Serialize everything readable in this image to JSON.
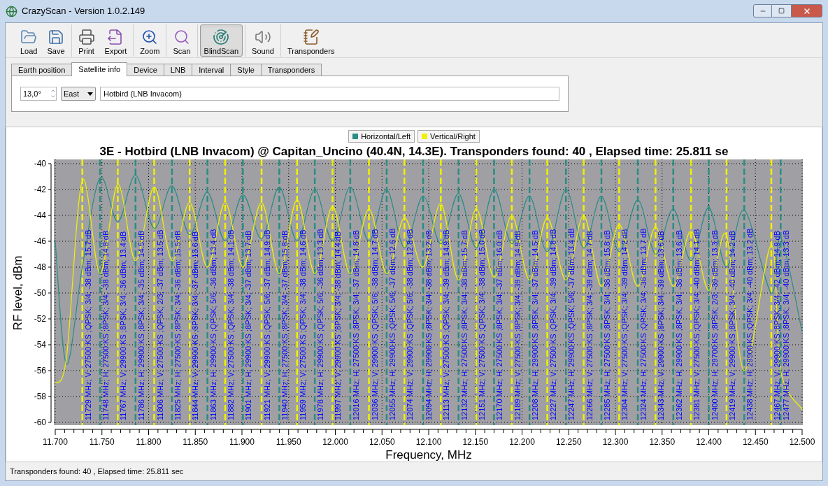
{
  "window": {
    "title": "CrazyScan - Version 1.0.2.149"
  },
  "toolbar": [
    {
      "buttons": [
        {
          "kind": "load",
          "label": "Load",
          "pressed": false
        },
        {
          "kind": "save",
          "label": "Save",
          "pressed": false
        }
      ]
    },
    {
      "buttons": [
        {
          "kind": "print",
          "label": "Print",
          "pressed": false
        },
        {
          "kind": "export",
          "label": "Export",
          "pressed": false
        }
      ]
    },
    {
      "buttons": [
        {
          "kind": "zoom",
          "label": "Zoom",
          "pressed": false
        }
      ]
    },
    {
      "buttons": [
        {
          "kind": "scan",
          "label": "Scan",
          "pressed": false
        }
      ]
    },
    {
      "buttons": [
        {
          "kind": "blindscan",
          "label": "BlindScan",
          "pressed": true
        }
      ]
    },
    {
      "buttons": [
        {
          "kind": "sound",
          "label": "Sound",
          "pressed": false
        }
      ]
    },
    {
      "buttons": [
        {
          "kind": "transponders",
          "label": "Transponders",
          "pressed": false
        }
      ]
    }
  ],
  "tabs": [
    {
      "label": "Earth position",
      "selected": false
    },
    {
      "label": "Satellite info",
      "selected": true
    },
    {
      "label": "Device",
      "selected": false
    },
    {
      "label": "LNB",
      "selected": false
    },
    {
      "label": "Interval",
      "selected": false
    },
    {
      "label": "Style",
      "selected": false
    },
    {
      "label": "Transponders",
      "selected": false
    }
  ],
  "satellite_info": {
    "position": "13,0°",
    "direction": "East",
    "name": "Hotbird (LNB Invacom)"
  },
  "chart": {
    "title": "3E - Hotbird (LNB Invacom) @ Capitan_Uncino (40.4N, 14.3E). Transponders found: 40 , Elapsed time: 25.811 se",
    "chart_data": {
      "type": "line",
      "xlabel": "Frequency, MHz",
      "ylabel": "RF level, dBm",
      "xlim": [
        11.7,
        12.5
      ],
      "ylim": [
        -60,
        -40
      ],
      "xticks": [
        {
          "value": 11.7,
          "label": "11.700"
        },
        {
          "value": 11.75,
          "label": "11.750"
        },
        {
          "value": 11.8,
          "label": "11.800"
        },
        {
          "value": 11.85,
          "label": "11.850"
        },
        {
          "value": 11.9,
          "label": "11.900"
        },
        {
          "value": 11.95,
          "label": "11.950"
        },
        {
          "value": 12.0,
          "label": "12.000"
        },
        {
          "value": 12.05,
          "label": "12.050"
        },
        {
          "value": 12.1,
          "label": "12.100"
        },
        {
          "value": 12.15,
          "label": "12.150"
        },
        {
          "value": 12.2,
          "label": "12.200"
        },
        {
          "value": 12.25,
          "label": "12.250"
        },
        {
          "value": 12.3,
          "label": "12.300"
        },
        {
          "value": 12.35,
          "label": "12.350"
        },
        {
          "value": 12.4,
          "label": "12.400"
        },
        {
          "value": 12.45,
          "label": "12.450"
        },
        {
          "value": 12.5,
          "label": "12.500"
        }
      ],
      "grid": true,
      "yticks": [
        -40,
        -42,
        -44,
        -46,
        -48,
        -50,
        -52,
        -54,
        -56,
        -58,
        -60
      ],
      "x": [
        11.7,
        11.712,
        11.729,
        11.748,
        11.767,
        11.786,
        11.806,
        11.825,
        11.844,
        11.863,
        11.882,
        11.901,
        11.921,
        11.94,
        11.959,
        11.978,
        11.997,
        12.016,
        12.036,
        12.055,
        12.074,
        12.094,
        12.113,
        12.132,
        12.151,
        12.17,
        12.189,
        12.208,
        12.227,
        12.247,
        12.266,
        12.285,
        12.304,
        12.324,
        12.343,
        12.362,
        12.381,
        12.4,
        12.419,
        12.438,
        12.467,
        12.477,
        12.5
      ],
      "series": [
        {
          "name": "Horizontal/Left",
          "color": "#2b8c84",
          "values": [
            -46,
            -55.5,
            -48,
            -41.1,
            -44.5,
            -40.9,
            -45,
            -41.7,
            -45.5,
            -42.2,
            -46,
            -42.4,
            -45.8,
            -41.8,
            -46,
            -42,
            -46,
            -41.8,
            -46,
            -42,
            -46.5,
            -42.5,
            -46.2,
            -42.3,
            -46.5,
            -42,
            -46.2,
            -42.5,
            -46.8,
            -42,
            -46.5,
            -42.5,
            -46.8,
            -42.8,
            -47,
            -43.5,
            -47.5,
            -43.4,
            -48,
            -43.6,
            -50,
            -45.7,
            -53
          ]
        },
        {
          "name": "Vertical/Right",
          "color": "#f0f000",
          "values": [
            -57,
            -55,
            -41.3,
            -48.5,
            -41.6,
            -47.5,
            -41.8,
            -47.5,
            -43,
            -48,
            -43,
            -48,
            -43,
            -48.5,
            -42.8,
            -48.5,
            -43.3,
            -48.5,
            -43.5,
            -48.5,
            -44.2,
            -48,
            -43.1,
            -49,
            -43.5,
            -48.8,
            -44,
            -49,
            -44.2,
            -49,
            -44,
            -49.5,
            -44.7,
            -49.5,
            -44.9,
            -49.5,
            -45.2,
            -49.8,
            -45.5,
            -56,
            -46.3,
            -56,
            -59
          ]
        }
      ],
      "ref_lines": [
        {
          "axis": "x",
          "value": 11.729,
          "color": "#f0f000",
          "label": "11729 MHz; V; 27500 KS ;QPSK; 3/4; -38 dBm; 15.7 dB"
        },
        {
          "axis": "x",
          "value": 11.748,
          "color": "#2b8c84",
          "label": "11748 MHz; H; 27500 KS ;8PSK; 3/4; -38 dBm; 14.8 dB"
        },
        {
          "axis": "x",
          "value": 11.767,
          "color": "#f0f000",
          "label": "11767 MHz; V; 29900 KS ;8PSK; 3/4; -36 dBm; 13.4 dB"
        },
        {
          "axis": "x",
          "value": 11.786,
          "color": "#2b8c84",
          "label": "11786 MHz; H; 29900 KS ;8PSK; 3/4; -35 dBm; 14.5 dB"
        },
        {
          "axis": "x",
          "value": 11.806,
          "color": "#f0f000",
          "label": "11806 MHz; V; 27500 KS ;QPSK; 2/3; -37 dBm; 13.5 dB"
        },
        {
          "axis": "x",
          "value": 11.825,
          "color": "#2b8c84",
          "label": "11825 MHz; H; 27500 KS ;8PSK; 3/4; -36 dBm; 15.5 dB"
        },
        {
          "axis": "x",
          "value": 11.844,
          "color": "#f0f000",
          "label": "11844 MHz; V; 29900 KS ;8PSK; 3/4; -37 dBm; 13.6 dB"
        },
        {
          "axis": "x",
          "value": 11.863,
          "color": "#2b8c84",
          "label": "11863 MHz; H; 29900 KS ;QPSK; 5/6; -36 dBm; 13.4 dB"
        },
        {
          "axis": "x",
          "value": 11.882,
          "color": "#f0f000",
          "label": "11882 MHz; V; 27500 KS ;QPSK; 3/4; -38 dBm; 14.1 dB"
        },
        {
          "axis": "x",
          "value": 11.901,
          "color": "#2b8c84",
          "label": "11901 MHz; H; 29900 KS ;8PSK; 3/4; -37 dBm; 13.7 dB"
        },
        {
          "axis": "x",
          "value": 11.921,
          "color": "#f0f000",
          "label": "11921 MHz; V; 29900 KS ;QPSK; 5/6; -37 dBm; 14.9 dB"
        },
        {
          "axis": "x",
          "value": 11.94,
          "color": "#2b8c84",
          "label": "11940 MHz; H; 27500 KS ;8PSK; 3/4; -37 dBm; 15.8 dB"
        },
        {
          "axis": "x",
          "value": 11.959,
          "color": "#f0f000",
          "label": "11959 MHz; V; 27500 KS ;QPSK; 3/4; -38 dBm; 14.6 dB"
        },
        {
          "axis": "x",
          "value": 11.978,
          "color": "#2b8c84",
          "label": "11978 MHz; H; 29900 KS ;QPSK; 5/6; -36 dBm; 13.3 dB"
        },
        {
          "axis": "x",
          "value": 11.997,
          "color": "#f0f000",
          "label": "11997 MHz; V; 29900 KS ;8PSK; 3/4; -38 dBm; 14.4 dB"
        },
        {
          "axis": "x",
          "value": 12.016,
          "color": "#2b8c84",
          "label": "12016 MHz; H; 27500 KS ;8PSK; 3/4; -37 dBm; 14.8 dB"
        },
        {
          "axis": "x",
          "value": 12.036,
          "color": "#f0f000",
          "label": "12036 MHz; V; 29900 KS ;QPSK; 5/6; -38 dBm; 14.7 dB"
        },
        {
          "axis": "x",
          "value": 12.055,
          "color": "#2b8c84",
          "label": "12055 MHz; H; 29900 KS ;QPSK; 5/6; -37 dBm; 12.6 dB"
        },
        {
          "axis": "x",
          "value": 12.074,
          "color": "#f0f000",
          "label": "12074 MHz; V; 29900 KS ;QPSK; 5/6; -38 dBm; 12.8 dB"
        },
        {
          "axis": "x",
          "value": 12.094,
          "color": "#2b8c84",
          "label": "12094 MHz; H; 29900 KS ;8PSK; 3/4; -38 dBm; 13.2 dB"
        },
        {
          "axis": "x",
          "value": 12.113,
          "color": "#f0f000",
          "label": "12113 MHz; V; 27500 KS ;QPSK; 3/4; -39 dBm; 14.9 dB"
        },
        {
          "axis": "x",
          "value": 12.132,
          "color": "#2b8c84",
          "label": "12132 MHz; H; 27500 KS ;8PSK; 3/4; -38 dBm; 15.7 dB"
        },
        {
          "axis": "x",
          "value": 12.151,
          "color": "#f0f000",
          "label": "12151 MHz; V; 27500 KS ;QPSK; 3/4; -38 dBm; 15.0 dB"
        },
        {
          "axis": "x",
          "value": 12.17,
          "color": "#2b8c84",
          "label": "12170 MHz; H; 27500 KS ;8PSK; 3/4; -37 dBm; 16.0 dB"
        },
        {
          "axis": "x",
          "value": 12.189,
          "color": "#f0f000",
          "label": "12189 MHz; V; 27500 KS ;8PSK; 3/4; -39 dBm; 14.9 dB"
        },
        {
          "axis": "x",
          "value": 12.208,
          "color": "#2b8c84",
          "label": "12208 MHz; H; 29900 KS ;8PSK; 3/4; -37 dBm; 14.5 dB"
        },
        {
          "axis": "x",
          "value": 12.227,
          "color": "#f0f000",
          "label": "12227 MHz; V; 27500 KS ;QPSK; 3/4; -39 dBm; 14.8 dB"
        },
        {
          "axis": "x",
          "value": 12.247,
          "color": "#2b8c84",
          "label": "12247 MHz; H; 29900 KS ;QPSK; 5/6; -37 dBm; 13.4 dB"
        },
        {
          "axis": "x",
          "value": 12.266,
          "color": "#f0f000",
          "label": "12266 MHz; V; 27500 KS ;8PSK; 3/4; -39 dBm; 14.7 dB"
        },
        {
          "axis": "x",
          "value": 12.285,
          "color": "#2b8c84",
          "label": "12285 MHz; H; 27500 KS ;8PSK; 3/4; -38 dBm; 15.8 dB"
        },
        {
          "axis": "x",
          "value": 12.304,
          "color": "#f0f000",
          "label": "12304 MHz; V; 27500 KS ;QPSK; 3/4; -39 dBm; 14.2 dB"
        },
        {
          "axis": "x",
          "value": 12.324,
          "color": "#2b8c84",
          "label": "12324 MHz; H; 27500 KS ;QPSK; 3/4; -38 dBm; 13.7 dB"
        },
        {
          "axis": "x",
          "value": 12.343,
          "color": "#f0f000",
          "label": "12343 MHz; V; 29900 KS ;8PSK; 3/4; -39 dBm; 13.6 dB"
        },
        {
          "axis": "x",
          "value": 12.362,
          "color": "#2b8c84",
          "label": "12362 MHz; H; 29900 KS ;8PSK; 3/4; -38 dBm; 13.6 dB"
        },
        {
          "axis": "x",
          "value": 12.381,
          "color": "#f0f000",
          "label": "12381 MHz; V; 27500 KS ;QPSK; 3/4; -40 dBm; 14.1 dB"
        },
        {
          "axis": "x",
          "value": 12.4,
          "color": "#2b8c84",
          "label": "12400 MHz; H; 29700 KS ;8PSK; 2/3; -39 dBm; 13.3 dB"
        },
        {
          "axis": "x",
          "value": 12.419,
          "color": "#f0f000",
          "label": "12419 MHz; V; 29900 KS ;8PSK; 3/4; -40 dBm; 14.2 dB"
        },
        {
          "axis": "x",
          "value": 12.438,
          "color": "#2b8c84",
          "label": "12438 MHz; H; 29900 KS ;QPSK; 3/4; -40 dBm; 13.2 dB"
        },
        {
          "axis": "x",
          "value": 12.467,
          "color": "#f0f000",
          "label": "12467 MHz; V; 29900 KS ;8PSK; 3/4; -42 dBm; 14.9 dB"
        },
        {
          "axis": "x",
          "value": 12.477,
          "color": "#2b8c84",
          "label": "12477 MHz; H; 29900 KS ;8PSK; 3/4; -40 dBm; 13.3 dB"
        }
      ]
    }
  },
  "status_bar": "Transponders found: 40 , Elapsed time: 25.811 sec"
}
